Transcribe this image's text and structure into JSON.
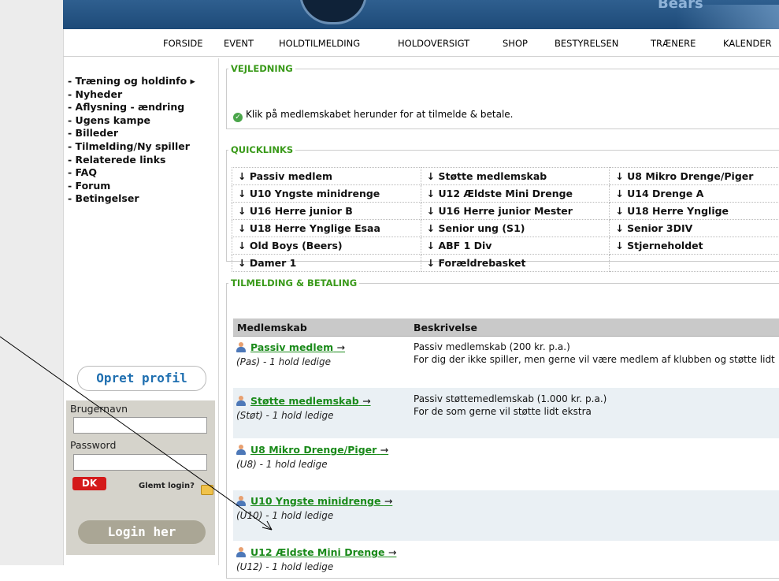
{
  "header": {
    "brand_text": "Bears"
  },
  "nav": {
    "items": [
      "FORSIDE",
      "EVENT",
      "HOLDTILMELDING",
      "HOLDOVERSIGT",
      "SHOP",
      "BESTYRELSEN",
      "TRÆNERE",
      "KALENDER"
    ]
  },
  "sidebar": {
    "items": [
      {
        "label": "- Træning og holdinfo ▸"
      },
      {
        "label": "- Nyheder"
      },
      {
        "label": "- Aflysning - ændring"
      },
      {
        "label": "- Ugens kampe"
      },
      {
        "label": "- Billeder"
      },
      {
        "label": "- Tilmelding/Ny spiller"
      },
      {
        "label": "- Relaterede links"
      },
      {
        "label": "- FAQ"
      },
      {
        "label": "- Forum"
      },
      {
        "label": "- Betingelser"
      }
    ]
  },
  "login": {
    "create_profile": "Opret profil",
    "username_label": "Brugernavn",
    "password_label": "Password",
    "dk_logo": "DK",
    "forgot": "Glemt login?",
    "submit": "Login her"
  },
  "vejledning": {
    "legend": "VEJLEDNING",
    "text": "Klik på medlemskabet herunder for at tilmelde & betale."
  },
  "quicklinks": {
    "legend": "QUICKLINKS",
    "rows": [
      [
        "↓ Passiv medlem",
        "↓ Støtte medlemskab",
        "↓ U8 Mikro Drenge/Piger"
      ],
      [
        "↓ U10 Yngste minidrenge",
        "↓ U12 Ældste Mini Drenge",
        "↓ U14 Drenge A"
      ],
      [
        "↓ U16 Herre junior B",
        "↓ U16 Herre junior Mester",
        "↓ U18 Herre Ynglige"
      ],
      [
        "↓ U18 Herre Ynglige Esaa",
        "↓ Senior ung (S1)",
        "↓ Senior 3DIV"
      ],
      [
        "↓ Old Boys (Beers)",
        "↓ ABF 1 Div",
        "↓ Stjerneholdet"
      ],
      [
        "↓ Damer 1",
        "↓ Forældrebasket",
        ""
      ]
    ]
  },
  "tilmelding": {
    "legend": "TILMELDING & BETALING",
    "col_membership": "Medlemskab",
    "col_description": "Beskrivelse",
    "arrow": "→",
    "rows": [
      {
        "name": "Passiv medlem",
        "sub": "(Pas) - 1 hold ledige",
        "desc1": "Passiv medlemskab  (200 kr. p.a.)",
        "desc2": "For dig der ikke spiller, men gerne vil være medlem af klubben og støtte lidt"
      },
      {
        "name": "Støtte medlemskab",
        "sub": "(Støt) - 1 hold ledige",
        "desc1": "Passiv støttemedlemskab (1.000 kr. p.a.)",
        "desc2": "For de som gerne vil støtte lidt ekstra"
      },
      {
        "name": "U8 Mikro Drenge/Piger",
        "sub": "(U8) - 1 hold ledige",
        "desc1": "",
        "desc2": ""
      },
      {
        "name": "U10 Yngste minidrenge",
        "sub": "(U10) - 1 hold ledige",
        "desc1": "",
        "desc2": ""
      },
      {
        "name": "U12 Ældste Mini Drenge",
        "sub": "(U12) - 1 hold ledige",
        "desc1": "",
        "desc2": ""
      }
    ]
  }
}
